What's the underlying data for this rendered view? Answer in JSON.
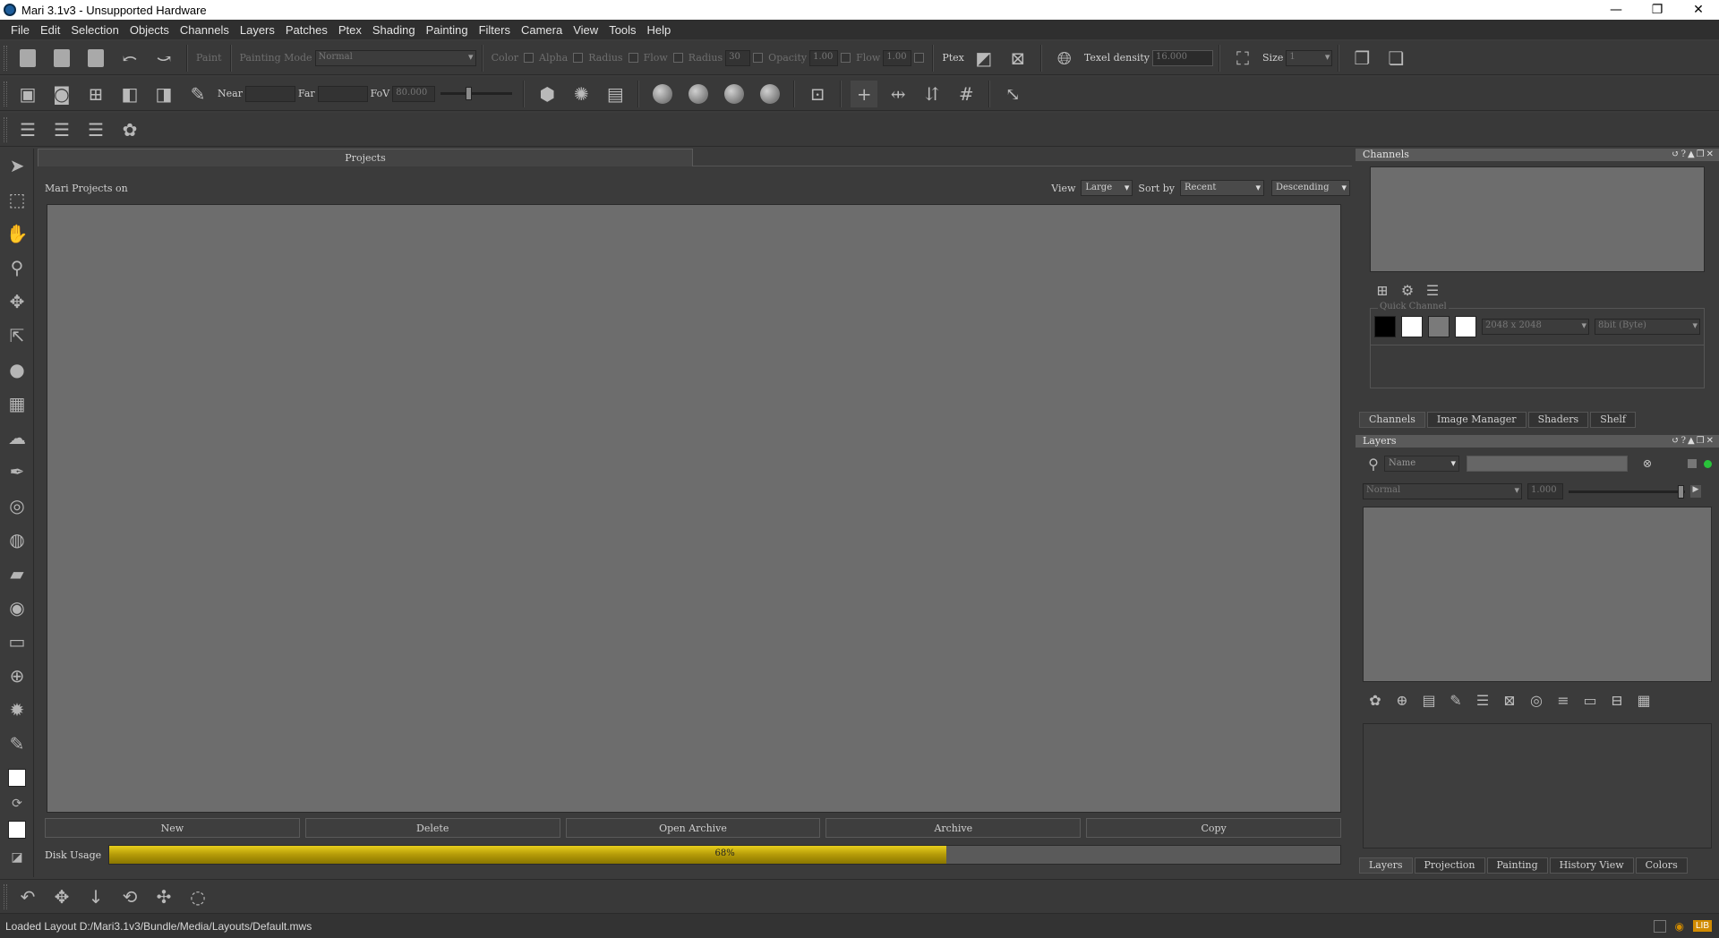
{
  "window": {
    "title": "Mari 3.1v3 - Unsupported Hardware",
    "minimize": "—",
    "maximize": "❐",
    "close": "✕"
  },
  "menu": [
    "File",
    "Edit",
    "Selection",
    "Objects",
    "Channels",
    "Layers",
    "Patches",
    "Ptex",
    "Shading",
    "Painting",
    "Filters",
    "Camera",
    "View",
    "Tools",
    "Help"
  ],
  "toolbar1": {
    "paint_label": "Paint",
    "painting_mode_label": "Painting Mode",
    "painting_mode_value": "Normal",
    "color_label": "Color",
    "alpha_label": "Alpha",
    "radius_label": "Radius",
    "flow_label": "Flow",
    "radius2_label": "Radius",
    "radius_value": "30",
    "opacity_label": "Opacity",
    "opacity_value": "1.00",
    "flow2_label": "Flow",
    "flow_value": "1.00",
    "ptex_label": "Ptex",
    "texel_label": "Texel density",
    "texel_value": "16.000",
    "size_label": "Size",
    "size_value": "1"
  },
  "toolbar2": {
    "near_label": "Near",
    "far_label": "Far",
    "fov_label": "FoV",
    "fov_value": "80.000"
  },
  "projects": {
    "tab": "Projects",
    "header_text": "Mari Projects on",
    "view_label": "View",
    "view_value": "Large",
    "sort_label": "Sort by",
    "sort_value": "Recent",
    "order_value": "Descending",
    "buttons": {
      "new": "New",
      "delete": "Delete",
      "open_archive": "Open Archive",
      "archive": "Archive",
      "copy": "Copy"
    },
    "disk_label": "Disk Usage",
    "disk_percent_text": "68%",
    "disk_fraction": 0.68
  },
  "channels_panel": {
    "title": "Channels",
    "controls": "↺?▲❐✕",
    "quick_channel_label": "Quick Channel",
    "resolution_value": "2048 x 2048",
    "depth_value": "8bit (Byte)",
    "tabs": [
      "Channels",
      "Image Manager",
      "Shaders",
      "Shelf"
    ]
  },
  "layers_panel": {
    "title": "Layers",
    "controls": "↺?▲❐✕",
    "filter_value": "Name",
    "blend_value": "Normal",
    "opacity_value": "1.000",
    "tabs": [
      "Layers",
      "Projection",
      "Painting",
      "History View",
      "Colors"
    ]
  },
  "status": {
    "message": "Loaded Layout D:/Mari3.1v3/Bundle/Media/Layouts/Default.mws",
    "badge": "LIB"
  },
  "colors": {
    "disk_fill": "#d4b812",
    "active_green": "#29c23a"
  }
}
